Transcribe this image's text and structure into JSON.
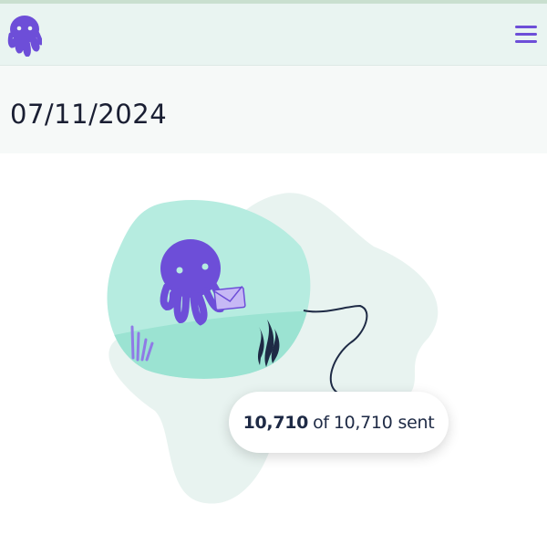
{
  "header": {
    "logo_icon": "octopus-logo-icon",
    "menu_icon": "hamburger-menu-icon",
    "brand_color": "#6d4ed8"
  },
  "campaign": {
    "date": "07/11/2024"
  },
  "progress": {
    "sent": "10,710",
    "of_text": "of",
    "total": "10,710",
    "status": "sent",
    "fraction": 1.0
  },
  "illustration": {
    "icons": [
      "octopus-icon",
      "envelope-icon",
      "seaweed-icon",
      "coral-icon"
    ]
  }
}
